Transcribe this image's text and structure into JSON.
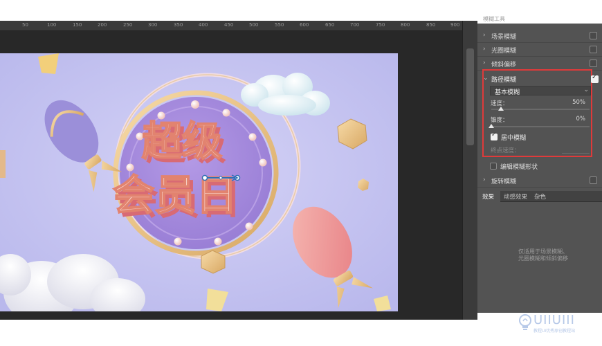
{
  "ruler": {
    "ticks": [
      "50",
      "100",
      "150",
      "200",
      "250",
      "300",
      "350",
      "400",
      "450",
      "500",
      "550",
      "600",
      "650",
      "700",
      "750",
      "800",
      "850",
      "900"
    ]
  },
  "artwork": {
    "title_line1": "超级",
    "title_line2": "会员日"
  },
  "panel": {
    "header_label": "模糊工具",
    "rows": [
      {
        "label": "场景模糊",
        "checked": false
      },
      {
        "label": "光圈模糊",
        "checked": false
      },
      {
        "label": "倾斜偏移",
        "checked": false
      }
    ],
    "path_blur": {
      "label": "路径模糊",
      "checked": true,
      "mode": "基本模糊",
      "speed_label": "速度：",
      "speed_value": "50%",
      "speed_level": 0.1,
      "taper_label": "锥度：",
      "taper_value": "0%",
      "taper_level": 0.0,
      "center_blur_label": "居中模糊",
      "center_blur_checked": true,
      "end_speed_label": "终点速度："
    },
    "edit_shapes_label": "编辑模糊形状",
    "spin_blur": {
      "label": "旋转模糊",
      "checked": false
    },
    "fx_tabs": [
      "效果",
      "动感效果",
      "杂色"
    ],
    "fx_note_line1": "仅适用于场景模糊、",
    "fx_note_line2": "光圈模糊和倾斜偏移"
  },
  "watermark": {
    "text": "UIIUIII",
    "sub": "教程UI优秀原创教程站"
  },
  "colors": {
    "accent_red": "#e03a3a",
    "panel_bg": "#535353",
    "canvas_bg": "#c6c6f0"
  }
}
